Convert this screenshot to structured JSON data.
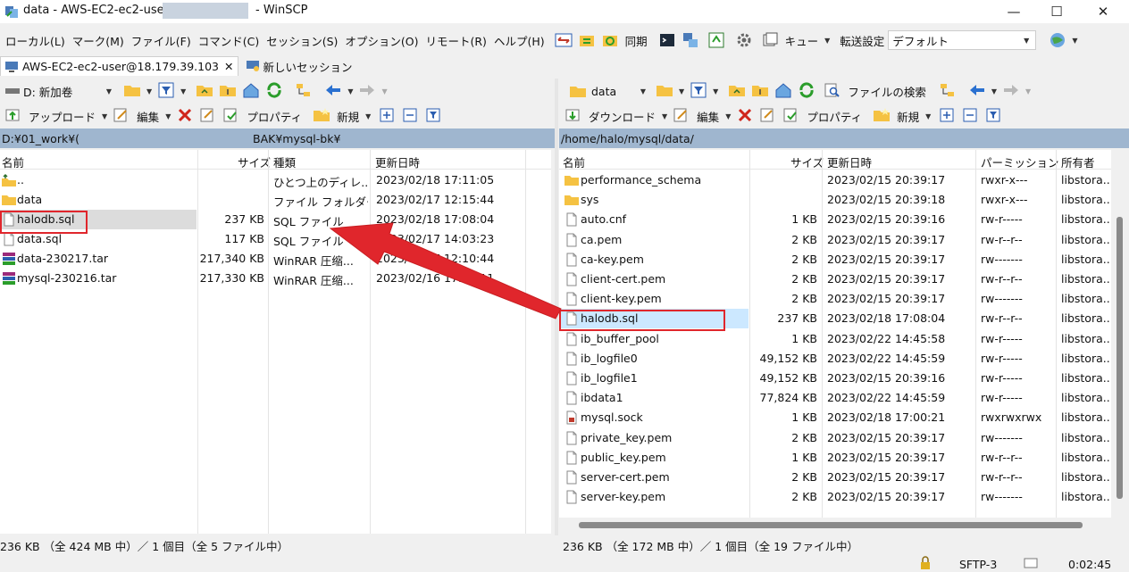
{
  "window": {
    "title_left": "data - AWS-EC2-ec2-user",
    "title_right": "- WinSCP",
    "controls": {
      "minimize": "—",
      "maximize": "☐",
      "close": "✕"
    }
  },
  "menu": {
    "items": [
      "ローカル(L)",
      "マーク(M)",
      "ファイル(F)",
      "コマンド(C)",
      "セッション(S)",
      "オプション(O)",
      "リモート(R)",
      "ヘルプ(H)"
    ],
    "sync_label": "同期",
    "queue_label": "キュー",
    "transfer_settings_label": "転送設定",
    "transfer_preset": "デフォルト"
  },
  "tabs": {
    "session": "AWS-EC2-ec2-user@18.179.39.103",
    "session_close": "✕",
    "new_session": "新しいセッション"
  },
  "left": {
    "drive": "D: 新加卷",
    "upload_label": "アップロード",
    "edit_label": "編集",
    "properties_label": "プロパティ",
    "new_label": "新規",
    "path_start": "D:¥01_work¥(",
    "path_end": "BAK¥mysql-bk¥",
    "columns": {
      "name": "名前",
      "size": "サイズ",
      "type": "種類",
      "modified": "更新日時"
    },
    "files": [
      {
        "name": "..",
        "size": "",
        "type": "ひとつ上のディレ...",
        "modified": "2023/02/18  17:11:05",
        "icon": "up-dir"
      },
      {
        "name": "data",
        "size": "",
        "type": "ファイル フォルダー",
        "modified": "2023/02/17  12:15:44",
        "icon": "folder"
      },
      {
        "name": "halodb.sql",
        "size": "237 KB",
        "type": "SQL ファイル",
        "modified": "2023/02/18  17:08:04",
        "icon": "file",
        "selected": true
      },
      {
        "name": "data.sql",
        "size": "117 KB",
        "type": "SQL ファイル",
        "modified": "2023/02/17  14:03:23",
        "icon": "file"
      },
      {
        "name": "data-230217.tar",
        "size": "217,340 KB",
        "type": "WinRAR 圧缩...",
        "modified": "2023/02/17  12:10:44",
        "icon": "winrar"
      },
      {
        "name": "mysql-230216.tar",
        "size": "217,330 KB",
        "type": "WinRAR 圧缩...",
        "modified": "2023/02/16  17:40:11",
        "icon": "winrar"
      }
    ],
    "status": "236 KB （全 424 MB 中）／ 1 個目（全 5 ファイル中）"
  },
  "right": {
    "dir": "data",
    "find_label": "ファイルの検索",
    "download_label": "ダウンロード",
    "edit_label": "編集",
    "properties_label": "プロパティ",
    "new_label": "新規",
    "path": "/home/halo/mysql/data/",
    "columns": {
      "name": "名前",
      "size": "サイズ",
      "modified": "更新日時",
      "perms": "パーミッション",
      "owner": "所有者"
    },
    "files": [
      {
        "name": "performance_schema",
        "size": "",
        "modified": "2023/02/15 20:39:17",
        "perms": "rwxr-x---",
        "owner": "libstora...",
        "icon": "folder"
      },
      {
        "name": "sys",
        "size": "",
        "modified": "2023/02/15 20:39:18",
        "perms": "rwxr-x---",
        "owner": "libstora...",
        "icon": "folder"
      },
      {
        "name": "auto.cnf",
        "size": "1 KB",
        "modified": "2023/02/15 20:39:16",
        "perms": "rw-r-----",
        "owner": "libstora...",
        "icon": "file"
      },
      {
        "name": "ca.pem",
        "size": "2 KB",
        "modified": "2023/02/15 20:39:17",
        "perms": "rw-r--r--",
        "owner": "libstora...",
        "icon": "file"
      },
      {
        "name": "ca-key.pem",
        "size": "2 KB",
        "modified": "2023/02/15 20:39:17",
        "perms": "rw-------",
        "owner": "libstora...",
        "icon": "file"
      },
      {
        "name": "client-cert.pem",
        "size": "2 KB",
        "modified": "2023/02/15 20:39:17",
        "perms": "rw-r--r--",
        "owner": "libstora...",
        "icon": "file"
      },
      {
        "name": "client-key.pem",
        "size": "2 KB",
        "modified": "2023/02/15 20:39:17",
        "perms": "rw-------",
        "owner": "libstora...",
        "icon": "file"
      },
      {
        "name": "halodb.sql",
        "size": "237 KB",
        "modified": "2023/02/18 17:08:04",
        "perms": "rw-r--r--",
        "owner": "libstora...",
        "icon": "file",
        "selected": true
      },
      {
        "name": "ib_buffer_pool",
        "size": "1 KB",
        "modified": "2023/02/22 14:45:58",
        "perms": "rw-r-----",
        "owner": "libstora...",
        "icon": "file"
      },
      {
        "name": "ib_logfile0",
        "size": "49,152 KB",
        "modified": "2023/02/22 14:45:59",
        "perms": "rw-r-----",
        "owner": "libstora...",
        "icon": "file"
      },
      {
        "name": "ib_logfile1",
        "size": "49,152 KB",
        "modified": "2023/02/15 20:39:16",
        "perms": "rw-r-----",
        "owner": "libstora...",
        "icon": "file"
      },
      {
        "name": "ibdata1",
        "size": "77,824 KB",
        "modified": "2023/02/22 14:45:59",
        "perms": "rw-r-----",
        "owner": "libstora...",
        "icon": "file"
      },
      {
        "name": "mysql.sock",
        "size": "1 KB",
        "modified": "2023/02/18 17:00:21",
        "perms": "rwxrwxrwx",
        "owner": "libstora...",
        "icon": "socket"
      },
      {
        "name": "private_key.pem",
        "size": "2 KB",
        "modified": "2023/02/15 20:39:17",
        "perms": "rw-------",
        "owner": "libstora...",
        "icon": "file"
      },
      {
        "name": "public_key.pem",
        "size": "1 KB",
        "modified": "2023/02/15 20:39:17",
        "perms": "rw-r--r--",
        "owner": "libstora...",
        "icon": "file"
      },
      {
        "name": "server-cert.pem",
        "size": "2 KB",
        "modified": "2023/02/15 20:39:17",
        "perms": "rw-r--r--",
        "owner": "libstora...",
        "icon": "file"
      },
      {
        "name": "server-key.pem",
        "size": "2 KB",
        "modified": "2023/02/15 20:39:17",
        "perms": "rw-------",
        "owner": "libstora...",
        "icon": "file"
      }
    ],
    "status": "236 KB （全 172 MB 中）／ 1 個目（全 19 ファイル中）"
  },
  "bottom": {
    "protocol": "SFTP-3",
    "elapsed": "0:02:45"
  },
  "colors": {
    "path_bar": "#9fb6cf",
    "selection": "#cce8ff",
    "annotation": "#e0262c",
    "folder": "#f5c242"
  }
}
